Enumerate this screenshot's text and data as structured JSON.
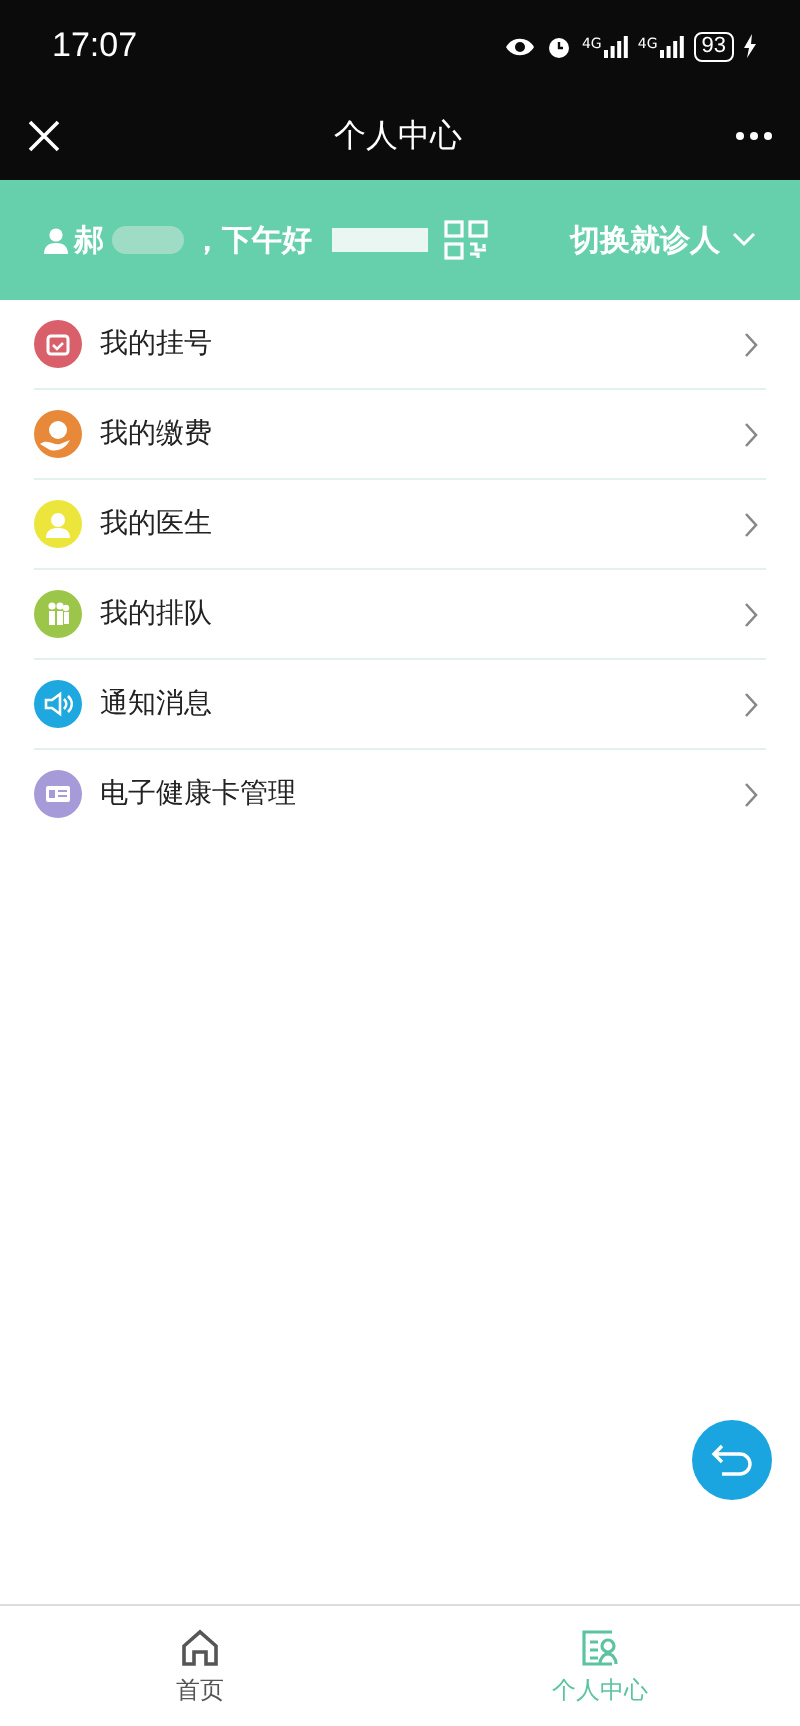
{
  "status_bar": {
    "time": "17:07",
    "signals": [
      {
        "label": "4G"
      },
      {
        "label": "4G"
      }
    ],
    "battery": "93"
  },
  "nav": {
    "title": "个人中心"
  },
  "banner": {
    "surname": "郝",
    "greeting": "，下午好",
    "switch_label": "切换就诊人"
  },
  "menu": [
    {
      "label": "我的挂号",
      "kind": "calendar",
      "color": "#d9606b"
    },
    {
      "label": "我的缴费",
      "kind": "payment",
      "color": "#e8893a"
    },
    {
      "label": "我的医生",
      "kind": "doctor",
      "color": "#ece63c"
    },
    {
      "label": "我的排队",
      "kind": "queue",
      "color": "#9cc64a"
    },
    {
      "label": "通知消息",
      "kind": "speaker",
      "color": "#1ea8df"
    },
    {
      "label": "电子健康卡管理",
      "kind": "card",
      "color": "#a79ad8"
    }
  ],
  "tabs": [
    {
      "label": "首页",
      "kind": "home",
      "selected": false
    },
    {
      "label": "个人中心",
      "kind": "profile",
      "selected": true
    }
  ]
}
